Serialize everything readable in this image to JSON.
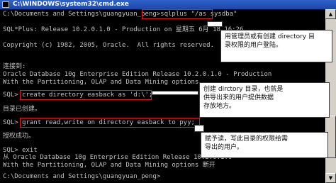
{
  "window": {
    "title": "C:\\WINDOWS\\system32\\cmd.exe"
  },
  "console": {
    "lines": [
      "C:\\Documents and Settings\\guangyuan_peng>sqlplus \"/as sysdba\"",
      "",
      "SQL*Plus: Release 10.2.0.1.0 - Production on 星期五 6月 18 16:26",
      "",
      "Copyright (c) 1982, 2005, Oracle.  All rights reserved.",
      "",
      "",
      "连接到:",
      "Oracle Database 10g Enterprise Edition Release 10.2.0.1.0 - Production",
      "With the Partitioning, OLAP and Data Mining options",
      "",
      "SQL> create directory easback as 'd:\\';",
      "",
      "目录已创建。",
      "",
      "SQL> grant read,write on directory easback to pyy;",
      "",
      "授权成功。",
      "",
      "SQL> exit",
      "从 Oracle Database 10g Enterprise Edition Release 10.2.0.1.0",
      "With the Partitioning, OLAP and Data Mining options 断开",
      "",
      "C:\\Documents and Settings\\guangyuan_peng>"
    ]
  },
  "callouts": [
    {
      "lines": [
        "用管理员或有创建 directory 目",
        "录权限的用户登陆。"
      ]
    },
    {
      "lines": [
        "创建 dirctory 目录，也就是",
        "供导出来的用户提供数据",
        "存放地方。"
      ]
    },
    {
      "lines": [
        "赋予读，写此目录的权限给需",
        "导出的用户。"
      ]
    }
  ],
  "scrollbar": {
    "up_glyph": "▲",
    "down_glyph": "▼"
  }
}
